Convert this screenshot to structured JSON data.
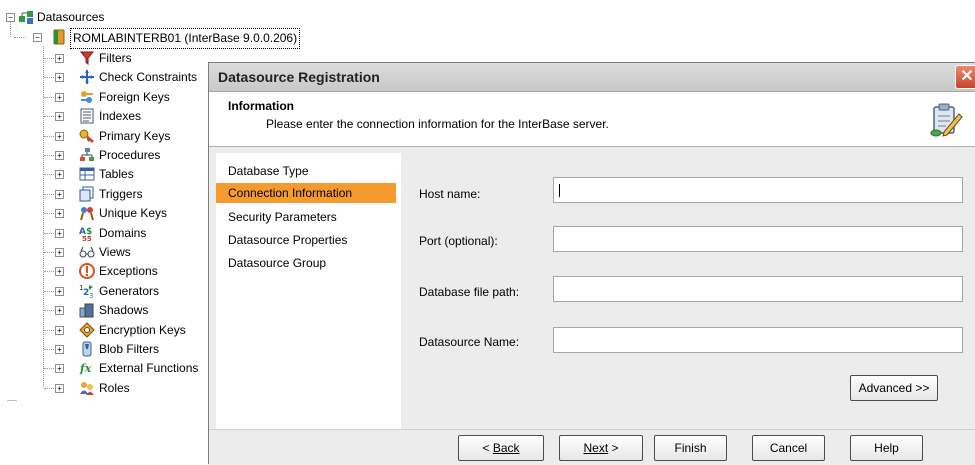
{
  "tree": {
    "root_label": "Datasources",
    "server_label": "ROMLABINTERB01 (InterBase 9.0.0.206)",
    "items": [
      {
        "label": "Filters",
        "icon": "filter-icon"
      },
      {
        "label": "Check Constraints",
        "icon": "check-constraints-icon"
      },
      {
        "label": "Foreign Keys",
        "icon": "foreign-keys-icon"
      },
      {
        "label": "Indexes",
        "icon": "indexes-icon"
      },
      {
        "label": "Primary Keys",
        "icon": "primary-keys-icon"
      },
      {
        "label": "Procedures",
        "icon": "procedures-icon"
      },
      {
        "label": "Tables",
        "icon": "tables-icon"
      },
      {
        "label": "Triggers",
        "icon": "triggers-icon"
      },
      {
        "label": "Unique Keys",
        "icon": "unique-keys-icon"
      },
      {
        "label": "Domains",
        "icon": "domains-icon"
      },
      {
        "label": "Views",
        "icon": "views-icon"
      },
      {
        "label": "Exceptions",
        "icon": "exceptions-icon"
      },
      {
        "label": "Generators",
        "icon": "generators-icon"
      },
      {
        "label": "Shadows",
        "icon": "shadows-icon"
      },
      {
        "label": "Encryption Keys",
        "icon": "encryption-keys-icon"
      },
      {
        "label": "Blob Filters",
        "icon": "blob-filters-icon"
      },
      {
        "label": "External Functions",
        "icon": "external-functions-icon"
      },
      {
        "label": "Roles",
        "icon": "roles-icon"
      }
    ]
  },
  "dialog": {
    "title": "Datasource Registration",
    "header_title": "Information",
    "header_subtitle": "Please enter the connection information for the InterBase server.",
    "steps": [
      {
        "label": "Database Type",
        "active": false
      },
      {
        "label": "Connection Information",
        "active": true
      },
      {
        "label": "Security Parameters",
        "active": false
      },
      {
        "label": "Datasource Properties",
        "active": false
      },
      {
        "label": "Datasource Group",
        "active": false
      }
    ],
    "fields": {
      "host_label": "Host name:",
      "host_value": "",
      "port_label": "Port (optional):",
      "port_value": "",
      "path_label": "Database file path:",
      "path_value": "",
      "name_label": "Datasource Name:",
      "name_value": ""
    },
    "advanced_label": "Advanced >>",
    "buttons": {
      "back": "Back",
      "next": "Next",
      "finish": "Finish",
      "cancel": "Cancel",
      "help": "Help"
    }
  },
  "colors": {
    "active_step": "#f59a2e",
    "close_button": "#c8442a"
  }
}
